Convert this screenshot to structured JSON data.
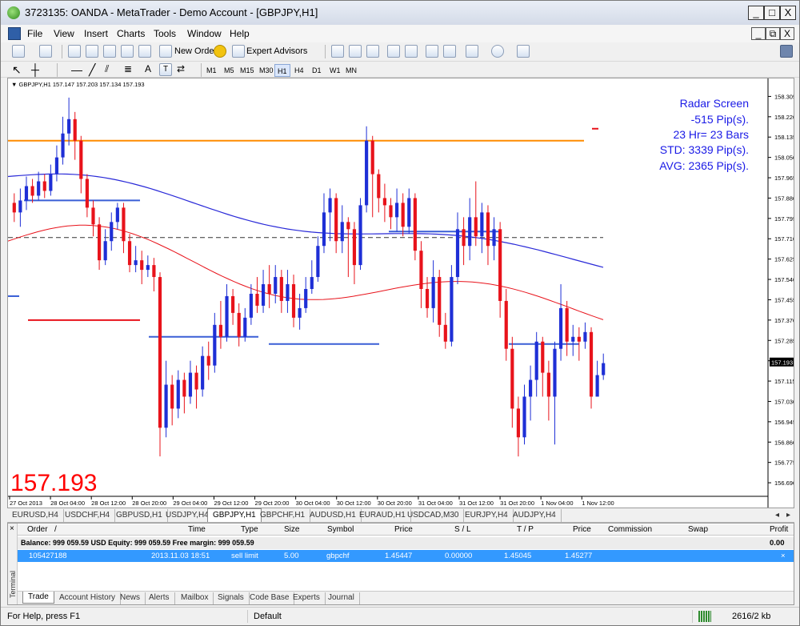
{
  "window": {
    "title": "3723135: OANDA - MetaTrader - Demo Account - [GBPJPY,H1]",
    "minimize": "_",
    "maximize": "□",
    "close": "X"
  },
  "menu": {
    "items": [
      "File",
      "View",
      "Insert",
      "Charts",
      "Tools",
      "Window",
      "Help"
    ],
    "mdi_minimize": "_",
    "mdi_restore": "⧉",
    "mdi_close": "X"
  },
  "toolbar": {
    "new_order": "New Order",
    "expert_advisors": "Expert Advisors",
    "text_tool": "A",
    "label_tool": "T"
  },
  "timeframes": {
    "items": [
      "M1",
      "M5",
      "M15",
      "M30",
      "H1",
      "H4",
      "D1",
      "W1",
      "MN"
    ],
    "active": "H1"
  },
  "chart": {
    "header": "▼ GBPJPY,H1  157.147 157.203 157.134 157.193",
    "big_price": "157.193",
    "current_price_label": "157.193",
    "radar": {
      "line1": "Radar Screen",
      "line2": "-515 Pip(s).",
      "line3": "23 Hr= 23 Bars",
      "line4": "STD: 3339 Pip(s).",
      "line5": "AVG: 2365 Pip(s)."
    },
    "colors": {
      "bull": "#1e2fd6",
      "bear": "#e8131b",
      "orange_line": "#ff8c00",
      "ma_blue": "#2a2ad8",
      "ma_red": "#e8131b",
      "level_blue": "#3a5fd6",
      "level_red": "#e8131b",
      "radar_text": "#1a1ae6",
      "big_price": "#ff0000"
    }
  },
  "chart_data": {
    "type": "candlestick",
    "symbol": "GBPJPY",
    "timeframe": "H1",
    "ylim": [
      156.64,
      158.36
    ],
    "y_ticks": [
      "158.305",
      "158.220",
      "158.135",
      "158.050",
      "157.965",
      "157.880",
      "157.795",
      "157.710",
      "157.625",
      "157.540",
      "157.455",
      "157.370",
      "157.285",
      "157.200",
      "157.115",
      "157.030",
      "156.945",
      "156.860",
      "156.775",
      "156.690"
    ],
    "x_ticks": [
      "27 Oct 2013",
      "28 Oct 04:00",
      "28 Oct 12:00",
      "28 Oct 20:00",
      "29 Oct 04:00",
      "29 Oct 12:00",
      "29 Oct 20:00",
      "30 Oct 04:00",
      "30 Oct 12:00",
      "30 Oct 20:00",
      "31 Oct 04:00",
      "31 Oct 12:00",
      "31 Oct 20:00",
      "1 Nov 04:00",
      "1 Nov 12:00"
    ],
    "levels": {
      "orange": 158.12,
      "dashed": 157.715,
      "blue_ma_start": 157.97,
      "blue_ma_end": 157.6,
      "red_ma_start": 157.7,
      "red_ma_end": 157.39
    },
    "candles": [
      [
        157.86,
        157.82,
        157.9,
        157.78
      ],
      [
        157.82,
        157.87,
        157.92,
        157.76
      ],
      [
        157.87,
        157.93,
        157.97,
        157.83
      ],
      [
        157.93,
        157.89,
        157.96,
        157.86
      ],
      [
        157.89,
        157.95,
        157.99,
        157.87
      ],
      [
        157.95,
        157.91,
        157.98,
        157.88
      ],
      [
        157.91,
        157.98,
        158.02,
        157.89
      ],
      [
        157.98,
        158.05,
        158.1,
        157.95
      ],
      [
        158.05,
        158.15,
        158.22,
        158.02
      ],
      [
        158.15,
        158.21,
        158.3,
        158.1
      ],
      [
        158.21,
        158.12,
        158.24,
        158.04
      ],
      [
        158.12,
        157.96,
        158.14,
        157.9
      ],
      [
        157.96,
        157.84,
        157.98,
        157.8
      ],
      [
        157.84,
        157.77,
        157.87,
        157.72
      ],
      [
        157.77,
        157.62,
        157.8,
        157.58
      ],
      [
        157.62,
        157.7,
        157.75,
        157.6
      ],
      [
        157.7,
        157.78,
        157.82,
        157.66
      ],
      [
        157.78,
        157.84,
        157.86,
        157.75
      ],
      [
        157.84,
        157.7,
        157.86,
        157.65
      ],
      [
        157.7,
        157.6,
        157.73,
        157.57
      ],
      [
        157.6,
        157.62,
        157.68,
        157.57
      ],
      [
        157.62,
        157.58,
        157.66,
        157.52
      ],
      [
        157.58,
        157.6,
        157.64,
        157.55
      ],
      [
        157.6,
        157.55,
        157.63,
        157.49
      ],
      [
        157.55,
        156.92,
        157.57,
        156.8
      ],
      [
        156.92,
        157.1,
        157.2,
        156.88
      ],
      [
        157.1,
        157.0,
        157.14,
        156.93
      ],
      [
        157.0,
        157.12,
        157.16,
        156.96
      ],
      [
        157.12,
        157.05,
        157.15,
        156.98
      ],
      [
        157.05,
        157.15,
        157.2,
        157.02
      ],
      [
        157.15,
        157.08,
        157.18,
        157.0
      ],
      [
        157.08,
        157.22,
        157.26,
        157.05
      ],
      [
        157.22,
        157.18,
        157.28,
        157.12
      ],
      [
        157.18,
        157.35,
        157.4,
        157.15
      ],
      [
        157.35,
        157.3,
        157.45,
        157.25
      ],
      [
        157.3,
        157.47,
        157.52,
        157.28
      ],
      [
        157.47,
        157.4,
        157.5,
        157.35
      ],
      [
        157.4,
        157.3,
        157.44,
        157.26
      ],
      [
        157.3,
        157.38,
        157.42,
        157.28
      ],
      [
        157.38,
        157.48,
        157.52,
        157.35
      ],
      [
        157.48,
        157.43,
        157.55,
        157.4
      ],
      [
        157.43,
        157.52,
        157.58,
        157.4
      ],
      [
        157.52,
        157.48,
        157.6,
        157.42
      ],
      [
        157.48,
        157.55,
        157.6,
        157.44
      ],
      [
        157.55,
        157.45,
        157.58,
        157.4
      ],
      [
        157.45,
        157.52,
        157.58,
        157.4
      ],
      [
        157.52,
        157.38,
        157.56,
        157.34
      ],
      [
        157.38,
        157.42,
        157.48,
        157.33
      ],
      [
        157.42,
        157.5,
        157.55,
        157.4
      ],
      [
        157.5,
        157.55,
        157.62,
        157.48
      ],
      [
        157.55,
        157.68,
        157.72,
        157.53
      ],
      [
        157.68,
        157.82,
        157.9,
        157.65
      ],
      [
        157.82,
        157.88,
        157.92,
        157.7
      ],
      [
        157.88,
        157.7,
        157.9,
        157.65
      ],
      [
        157.7,
        157.78,
        157.85,
        157.65
      ],
      [
        157.78,
        157.75,
        157.8,
        157.55
      ],
      [
        157.75,
        157.6,
        157.78,
        157.52
      ],
      [
        157.6,
        157.85,
        157.88,
        157.58
      ],
      [
        157.85,
        158.12,
        158.18,
        157.82
      ],
      [
        158.12,
        157.98,
        158.14,
        157.8
      ],
      [
        157.98,
        157.88,
        158.0,
        157.82
      ],
      [
        157.88,
        157.85,
        157.94,
        157.78
      ],
      [
        157.85,
        157.8,
        157.88,
        157.75
      ],
      [
        157.8,
        157.86,
        157.92,
        157.74
      ],
      [
        157.86,
        157.76,
        157.9,
        157.72
      ],
      [
        157.76,
        157.88,
        157.92,
        157.73
      ],
      [
        157.88,
        157.66,
        157.9,
        157.62
      ],
      [
        157.66,
        157.5,
        157.7,
        157.42
      ],
      [
        157.5,
        157.42,
        157.55,
        157.38
      ],
      [
        157.42,
        157.55,
        157.62,
        157.36
      ],
      [
        157.55,
        157.35,
        157.58,
        157.3
      ],
      [
        157.35,
        157.28,
        157.4,
        157.25
      ],
      [
        157.28,
        157.55,
        157.6,
        157.26
      ],
      [
        157.55,
        157.75,
        157.82,
        157.52
      ],
      [
        157.75,
        157.68,
        157.8,
        157.6
      ],
      [
        157.68,
        157.8,
        157.88,
        157.62
      ],
      [
        157.8,
        157.72,
        157.95,
        157.68
      ],
      [
        157.72,
        157.82,
        157.86,
        157.65
      ],
      [
        157.82,
        157.68,
        157.85,
        157.6
      ],
      [
        157.68,
        157.75,
        157.8,
        157.62
      ],
      [
        157.75,
        157.45,
        157.78,
        157.38
      ],
      [
        157.45,
        157.25,
        157.5,
        157.2
      ],
      [
        157.25,
        157.0,
        157.3,
        156.92
      ],
      [
        157.0,
        156.88,
        157.05,
        156.8
      ],
      [
        156.88,
        157.05,
        157.1,
        156.85
      ],
      [
        157.05,
        157.12,
        157.18,
        156.95
      ],
      [
        157.12,
        157.28,
        157.32,
        157.05
      ],
      [
        157.28,
        157.15,
        157.3,
        157.05
      ],
      [
        157.15,
        157.05,
        157.2,
        156.95
      ],
      [
        157.05,
        157.25,
        157.28,
        156.85
      ],
      [
        157.25,
        157.42,
        157.52,
        157.2
      ],
      [
        157.42,
        157.28,
        157.45,
        157.22
      ],
      [
        157.28,
        157.3,
        157.35,
        157.22
      ],
      [
        157.3,
        157.28,
        157.34,
        157.2
      ],
      [
        157.28,
        157.32,
        157.36,
        157.25
      ],
      [
        157.32,
        157.05,
        157.34,
        157.0
      ],
      [
        157.05,
        157.14,
        157.2,
        157.08
      ],
      [
        157.14,
        157.19,
        157.23,
        157.12
      ]
    ]
  },
  "chart_tabs": {
    "items": [
      "EURUSD,H4",
      "USDCHF,H4",
      "GBPUSD,H1",
      "USDJPY,H4",
      "GBPJPY,H1",
      "GBPCHF,H1",
      "AUDUSD,H1",
      "EURAUD,H1",
      "USDCAD,M30",
      "EURJPY,H4",
      "AUDJPY,H4"
    ],
    "active": "GBPJPY,H1",
    "scroll_left": "◂",
    "scroll_right": "▸"
  },
  "terminal": {
    "close": "×",
    "side_label": "Terminal",
    "headers": [
      "Order",
      "/",
      "Time",
      "Type",
      "Size",
      "Symbol",
      "Price",
      "S / L",
      "T / P",
      "Price",
      "Commission",
      "Swap",
      "Profit"
    ],
    "balance_line": "Balance: 999 059.59 USD  Equity: 999 059.59  Free margin: 999 059.59",
    "balance_profit": "0.00",
    "row": {
      "order": "105427188",
      "time": "2013.11.03 18:51",
      "type": "sell limit",
      "size": "5.00",
      "symbol": "gbpchf",
      "price": "1.45447",
      "sl": "0.00000",
      "tp": "1.45045",
      "cur_price": "1.45277",
      "close": "×"
    },
    "tabs": [
      "Trade",
      "Account History",
      "News",
      "Alerts",
      "Mailbox",
      "Signals",
      "Code Base",
      "Experts",
      "Journal"
    ],
    "active_tab": "Trade"
  },
  "status": {
    "help": "For Help, press F1",
    "profile": "Default",
    "traffic": "2616/2 kb"
  }
}
